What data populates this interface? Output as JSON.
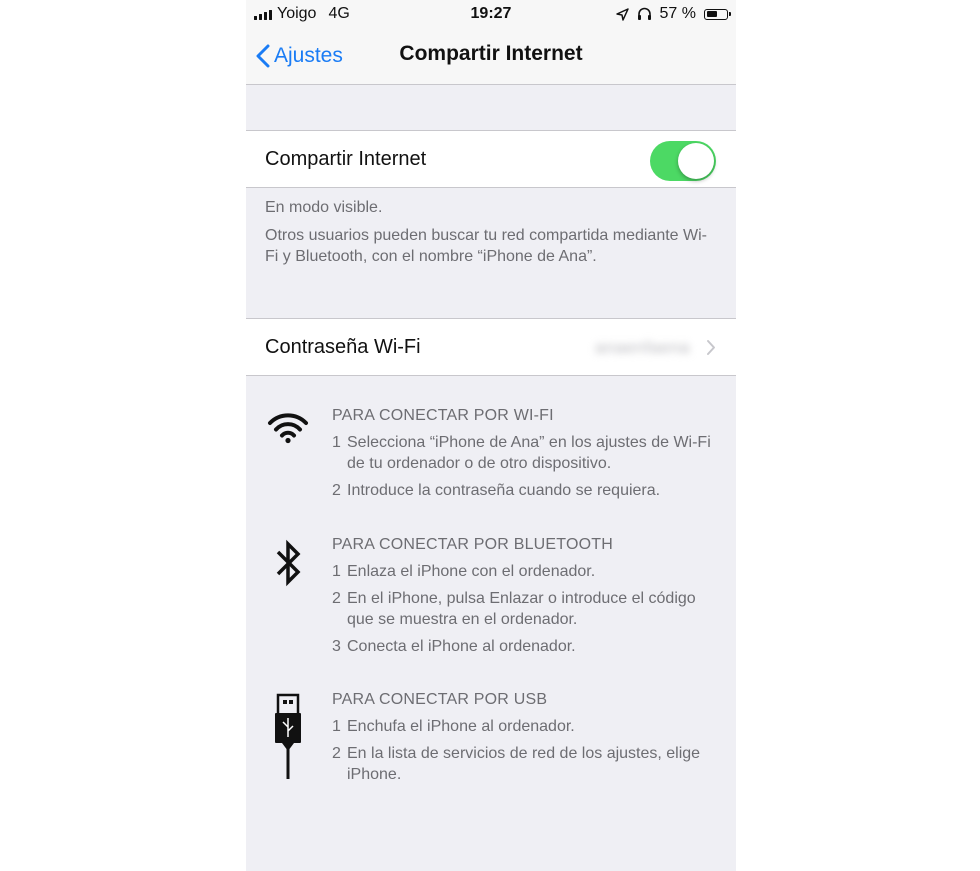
{
  "status_bar": {
    "carrier": "Yoigo",
    "network": "4G",
    "time": "19:27",
    "battery_percent_text": "57 %",
    "battery_level": 0.57
  },
  "nav": {
    "back_label": "Ajustes",
    "title": "Compartir Internet"
  },
  "hotspot": {
    "label": "Compartir Internet",
    "enabled": true,
    "toggle_color": "#4cd964"
  },
  "footer": {
    "visible_line": "En modo visible.",
    "description": "Otros usuarios pueden buscar tu red compartida mediante Wi-Fi y Bluetooth, con el nombre “iPhone de Ana”."
  },
  "wifi_password": {
    "label": "Contraseña Wi-Fi",
    "value": "anaenfaena"
  },
  "instructions": [
    {
      "icon": "wifi-icon",
      "title": "PARA CONECTAR POR WI-FI",
      "steps": [
        {
          "num": "1",
          "text": "Selecciona “iPhone de Ana” en los ajustes de Wi-Fi de tu ordenador o de otro dispositivo."
        },
        {
          "num": "2",
          "text": "Introduce la contraseña cuando se requiera."
        }
      ]
    },
    {
      "icon": "bluetooth-icon",
      "title": "PARA CONECTAR POR BLUETOOTH",
      "steps": [
        {
          "num": "1",
          "text": "Enlaza el iPhone con el ordenador."
        },
        {
          "num": "2",
          "text": "En el iPhone, pulsa Enlazar o introduce el código que se muestra en el ordenador."
        },
        {
          "num": "3",
          "text": "Conecta el iPhone al ordenador."
        }
      ]
    },
    {
      "icon": "usb-icon",
      "title": "PARA CONECTAR POR USB",
      "steps": [
        {
          "num": "1",
          "text": "Enchufa el iPhone al ordenador."
        },
        {
          "num": "2",
          "text": "En la lista de servicios de red de los ajustes, elige iPhone."
        }
      ]
    }
  ],
  "colors": {
    "accent": "#1a7cf5",
    "background": "#efeff4",
    "secondary_text": "#6d6d72"
  }
}
